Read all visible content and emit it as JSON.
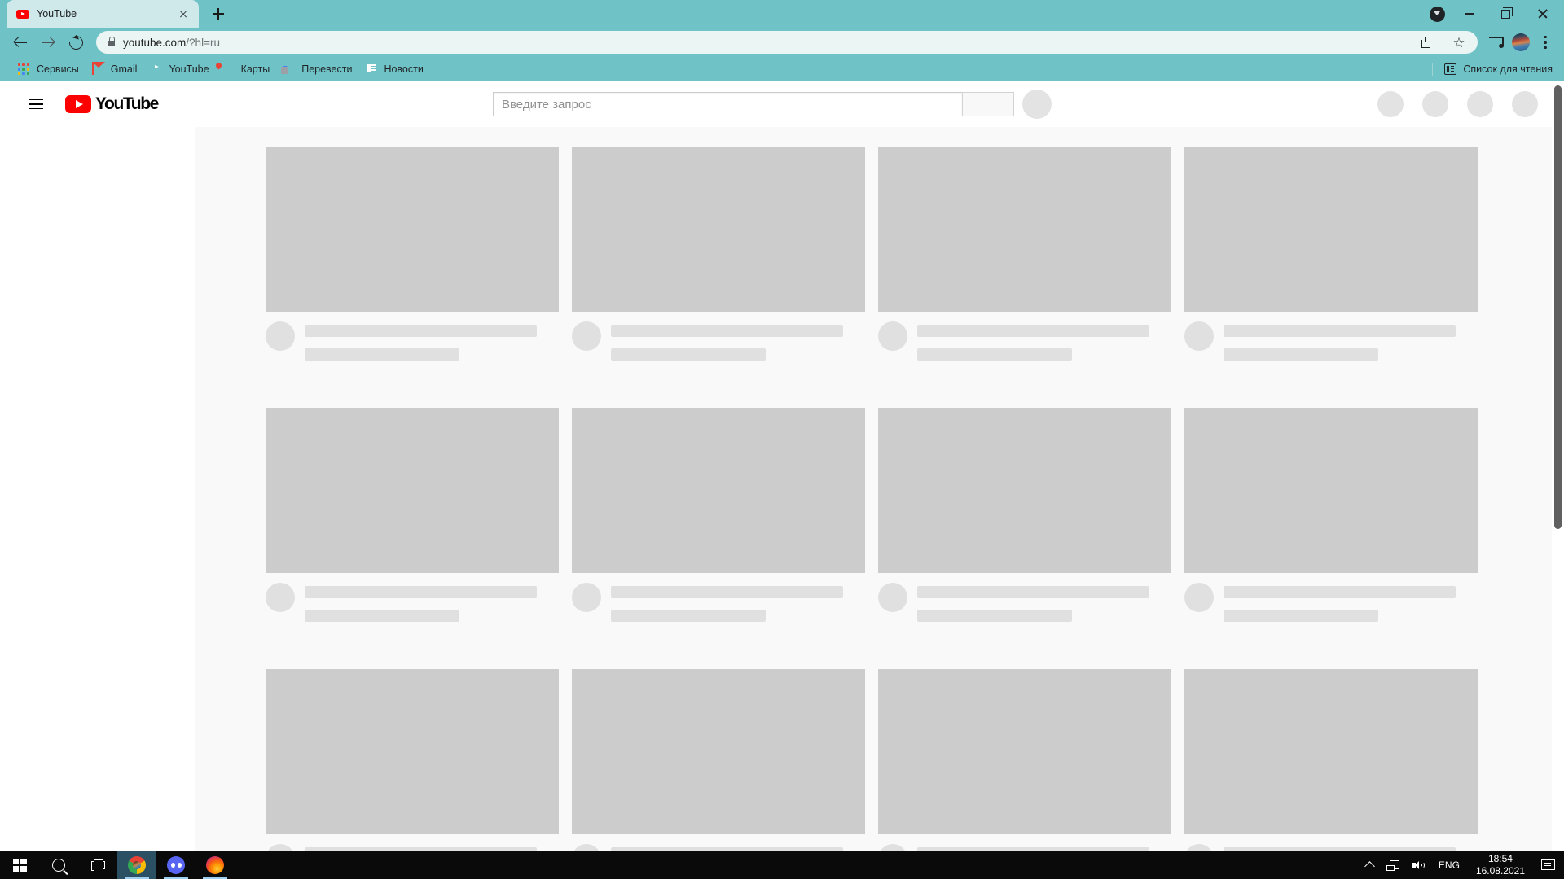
{
  "browser": {
    "tab": {
      "title": "YouTube",
      "favicon": "youtube-favicon"
    },
    "newtab_label": "+",
    "url": {
      "scheme_host": "youtube.com",
      "path": "/?hl=ru"
    },
    "window_controls": {
      "tab_search": "tab-search",
      "minimize": "—",
      "maximize": "□",
      "close": "✕"
    },
    "toolbar_icons": [
      "download-icon",
      "bookmark-star-icon",
      "media-control-icon",
      "profile-avatar",
      "chrome-menu-icon"
    ],
    "bookmarks": [
      {
        "label": "Сервисы",
        "icon": "google-apps-icon"
      },
      {
        "label": "Gmail",
        "icon": "gmail-icon"
      },
      {
        "label": "YouTube",
        "icon": "youtube-icon"
      },
      {
        "label": "Карты",
        "icon": "google-maps-icon"
      },
      {
        "label": "Перевести",
        "icon": "google-translate-icon"
      },
      {
        "label": "Новости",
        "icon": "google-news-icon"
      }
    ],
    "reading_list": {
      "label": "Список для чтения",
      "icon": "reading-list-icon"
    },
    "colors": {
      "chrome_theme": "#6fc2c6",
      "tab_active": "#cfe9ea",
      "omnibox": "#eaf5f4"
    }
  },
  "youtube": {
    "logo_text": "YouTube",
    "menu_icon": "hamburger-menu-icon",
    "search": {
      "placeholder": "Введите запрос",
      "value": "",
      "button_icon": "search-icon"
    },
    "voice_search": "voice-search-button",
    "header_right_placeholders": 4,
    "skeleton": {
      "rows": 3,
      "columns": 4,
      "card_count": 12,
      "thumb_color": "#cccccc",
      "bar_color": "#e0e0e0",
      "background": "#f9f9f9"
    },
    "scrollbar": {
      "position": "right",
      "thumb_top_pct": 1,
      "thumb_height_pct": 57
    }
  },
  "taskbar": {
    "start": "windows-start-icon",
    "search": "taskbar-search-icon",
    "task_view": "task-view-icon",
    "apps": [
      {
        "name": "Google Chrome",
        "icon": "chrome-icon",
        "state": "active"
      },
      {
        "name": "Discord",
        "icon": "discord-icon",
        "state": "running"
      },
      {
        "name": "Mozilla Firefox",
        "icon": "firefox-icon",
        "state": "running"
      }
    ],
    "tray": {
      "overflow": "show-hidden-icons-chevron",
      "network": "network-icon",
      "volume": "volume-icon",
      "language": "ENG",
      "time": "18:54",
      "date": "16.08.2021",
      "notifications": "action-center-icon"
    }
  }
}
